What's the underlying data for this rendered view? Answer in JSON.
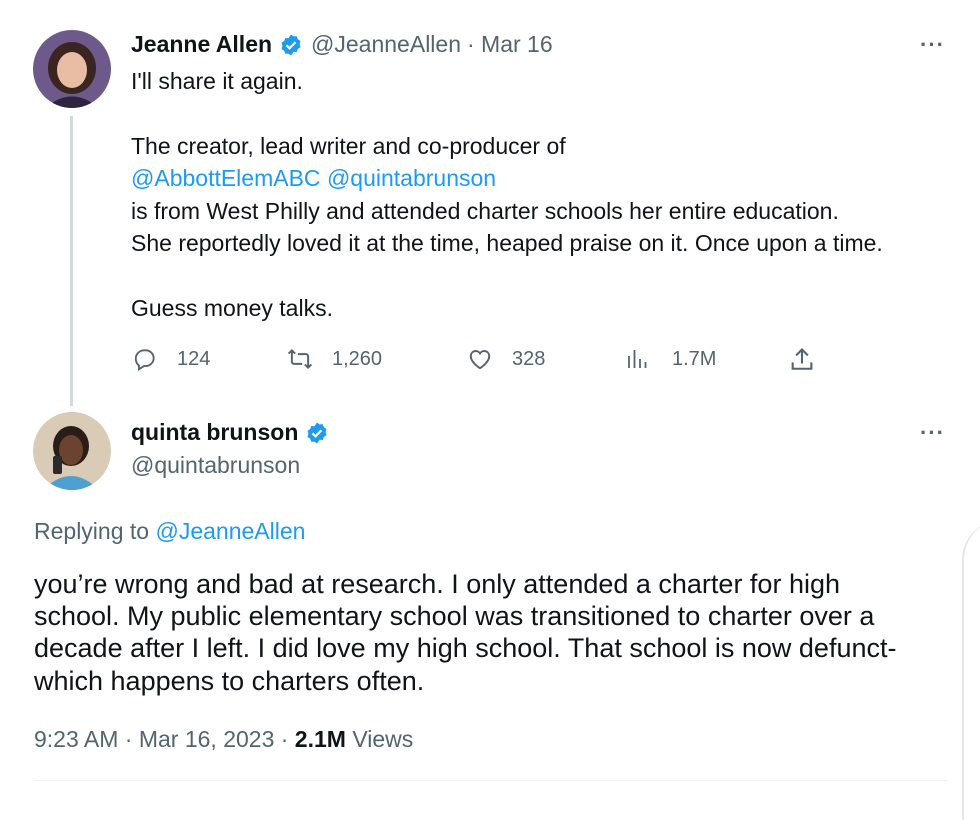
{
  "tweet1": {
    "name": "Jeanne Allen",
    "handle": "@JeanneAllen",
    "date": "· Mar 16",
    "lines": {
      "l1": "I'll share it again.",
      "l2": "The creator, lead writer and co-producer of",
      "mention1": "@AbbottElemABC",
      "mention2": "@quintabrunson",
      "l4": "is from West Philly and attended charter schools her entire education.",
      "l5": "She reportedly loved it at the time, heaped praise on it. Once upon a time.",
      "l6": "Guess money talks."
    },
    "actions": {
      "replies": "124",
      "retweets": "1,260",
      "likes": "328",
      "views": "1.7M"
    },
    "more": "···"
  },
  "tweet2": {
    "name": "quinta brunson",
    "handle": "@quintabrunson",
    "more": "···",
    "replying_prefix": "Replying to",
    "replying_handle": "@JeanneAllen",
    "lines": {
      "l1": "you’re wrong and bad at research. I only attended a charter for high",
      "l2": "school. My public elementary school was transitioned to charter over a",
      "l3": "decade after I left. I did love my high school. That school is now defunct-",
      "l4": "which happens to charters often."
    },
    "time": "9:23 AM · Mar 16, 2023 ·",
    "views_count": "2.1M",
    "views_label": "Views"
  },
  "colors": {
    "accent": "#1d9bf0",
    "muted": "#536471",
    "text": "#0f1419"
  }
}
